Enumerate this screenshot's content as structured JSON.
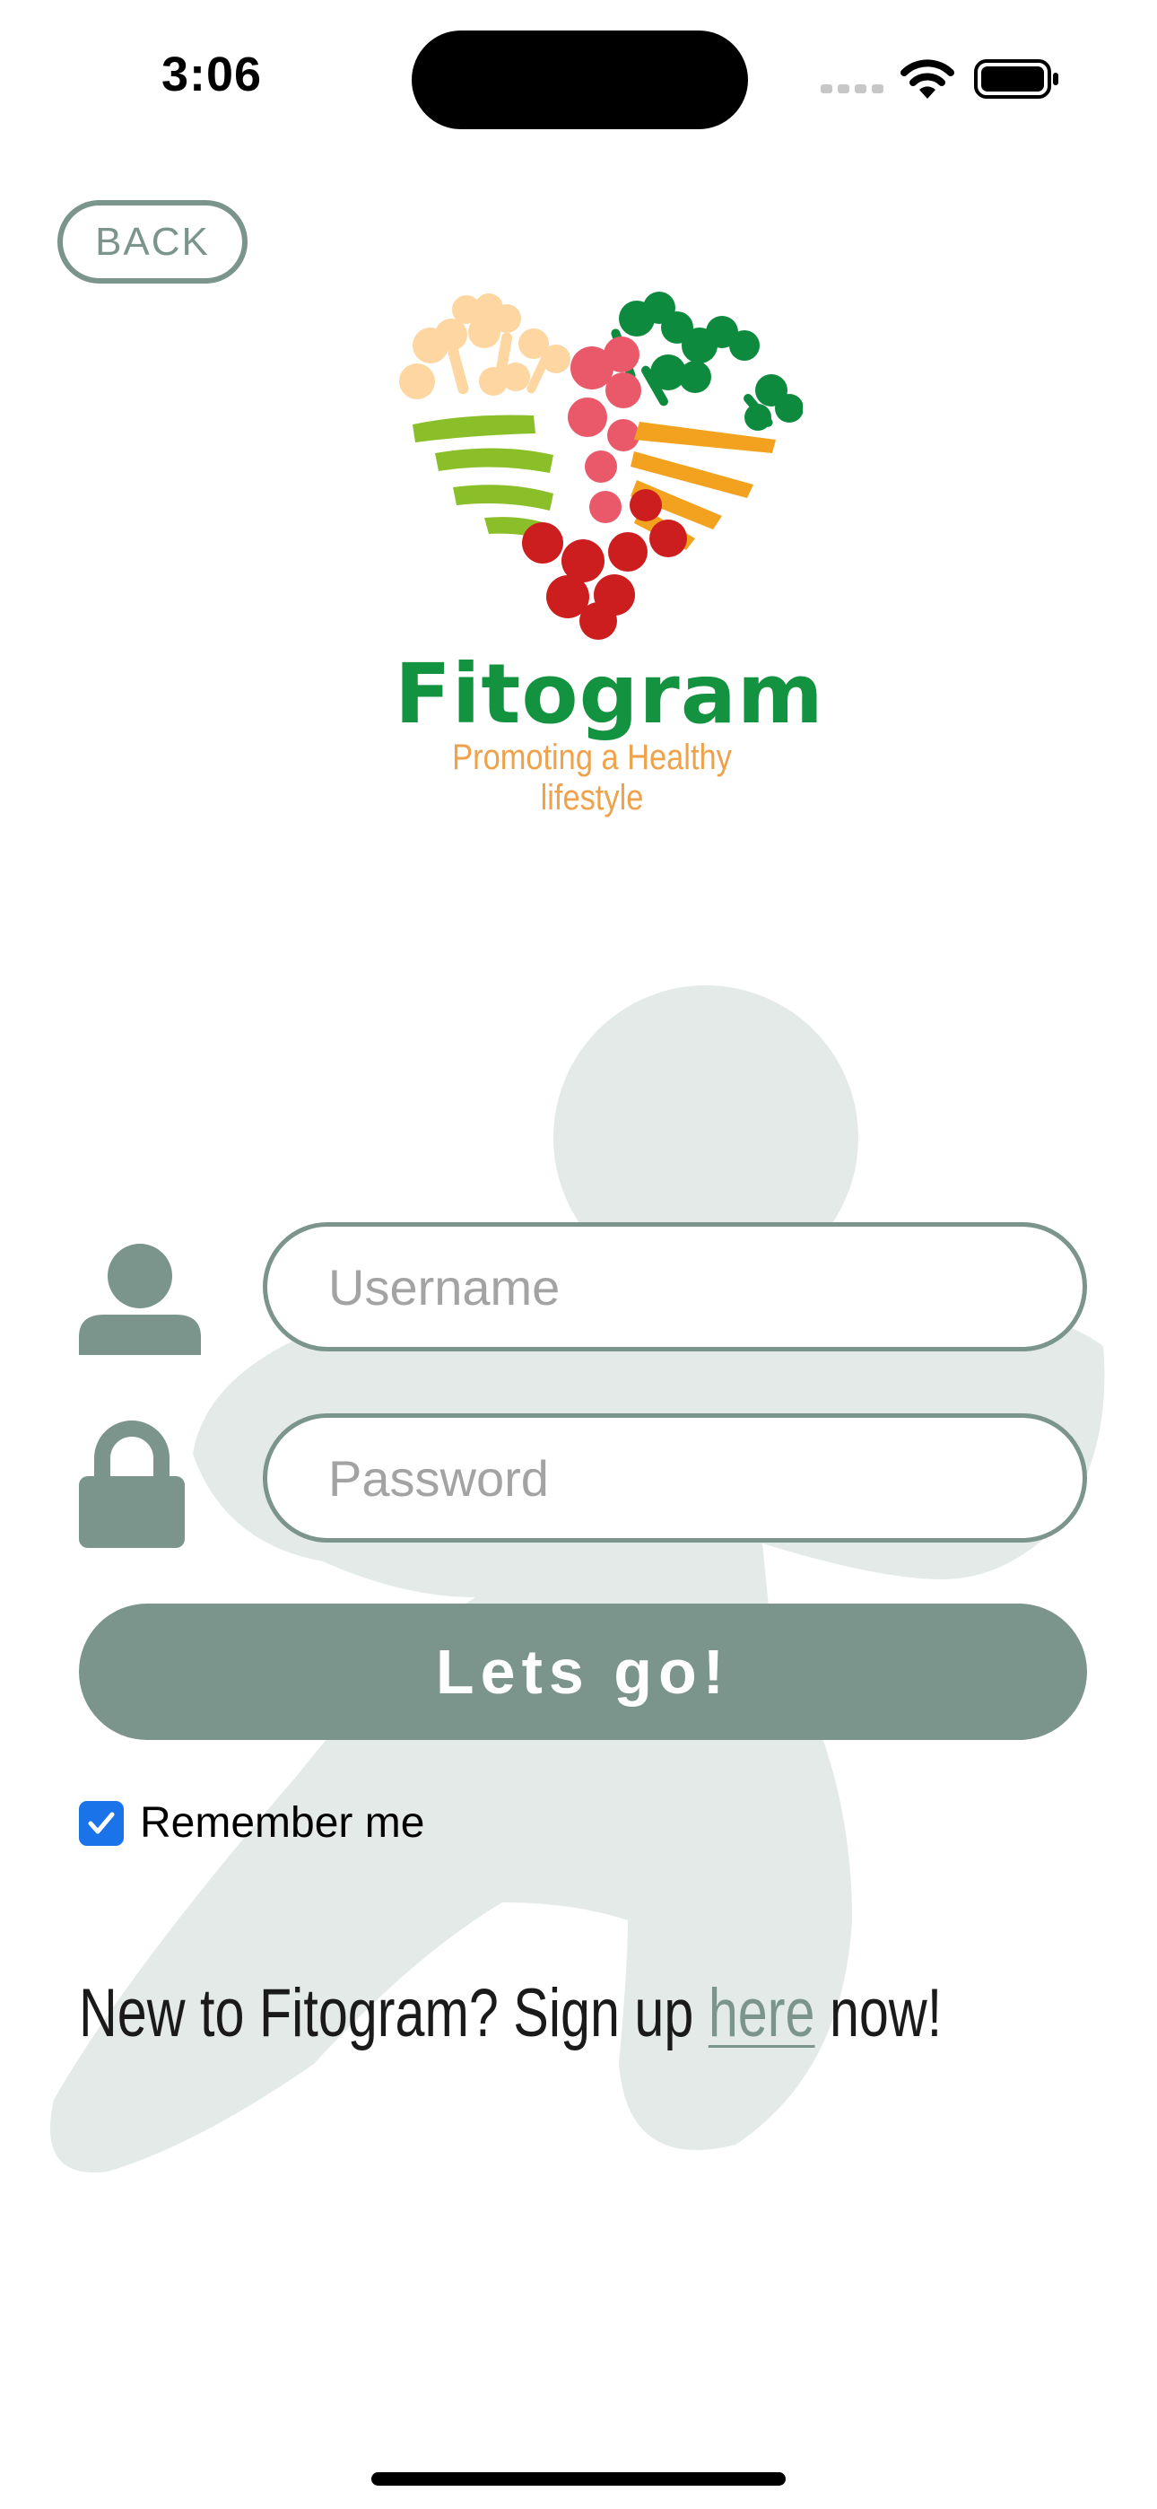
{
  "status_bar": {
    "time": "3:06",
    "icons": [
      "cellular-signal-icon",
      "wifi-icon",
      "battery-icon"
    ]
  },
  "nav": {
    "back_label": "BACK"
  },
  "brand": {
    "name": "Fitogram",
    "tagline": "Promoting a Healthy lifestyle"
  },
  "login": {
    "username_placeholder": "Username",
    "password_placeholder": "Password",
    "submit_label": "Lets go!",
    "remember_label": "Remember me",
    "remember_checked": true
  },
  "signup": {
    "prefix": "New to Fitogram? Sign up ",
    "link": "here",
    "suffix": " now!"
  },
  "colors": {
    "accent": "#7b948c",
    "brand_green": "#13923f",
    "tagline_orange": "#eda24b",
    "watermark": "#e3eae7",
    "checkbox_blue": "#1a73e8"
  }
}
